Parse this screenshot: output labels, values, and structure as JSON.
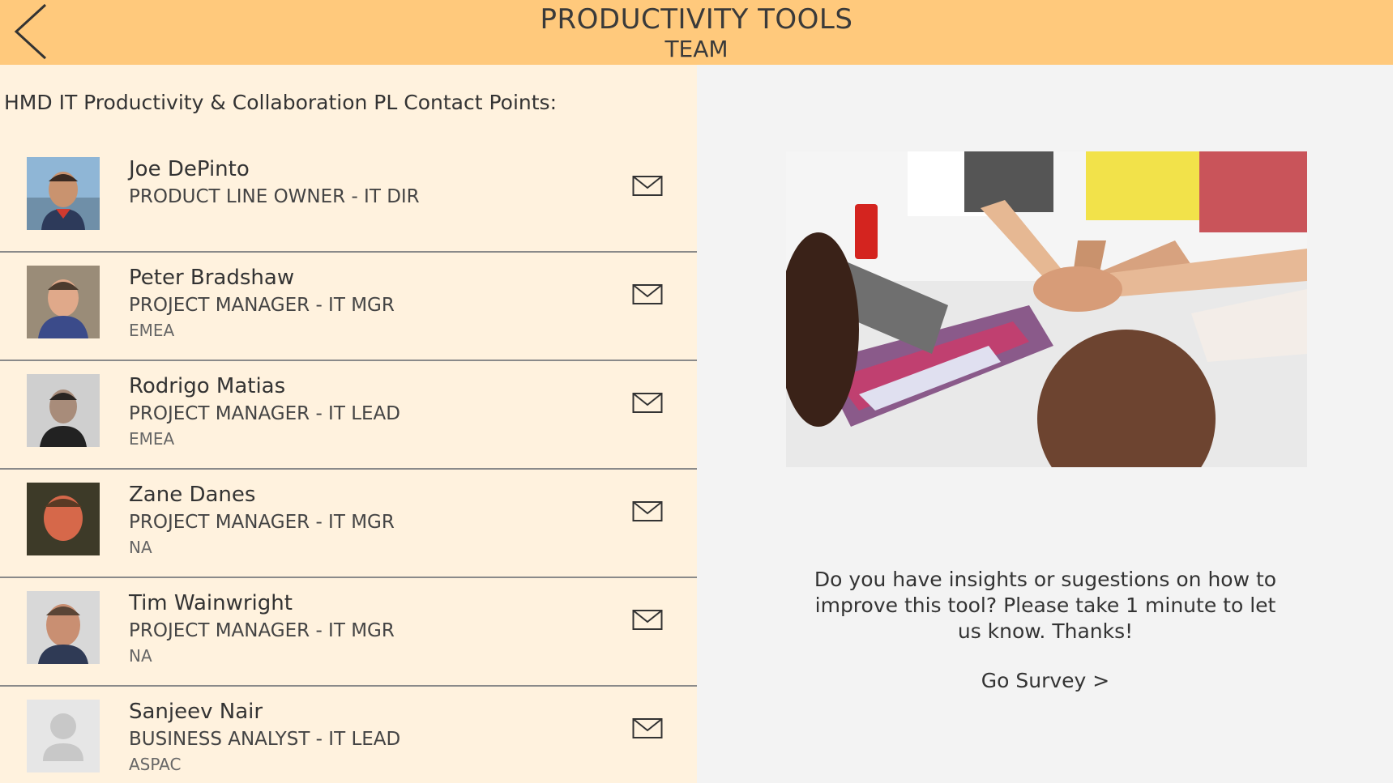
{
  "header": {
    "title": "PRODUCTIVITY TOOLS",
    "subtitle": "TEAM",
    "background_color": "#ffc97c"
  },
  "section_heading": "HMD IT Productivity & Collaboration PL Contact Points:",
  "contacts": [
    {
      "name": "Joe DePinto",
      "role": "PRODUCT LINE OWNER - IT DIR",
      "region": ""
    },
    {
      "name": "Peter Bradshaw",
      "role": "PROJECT MANAGER - IT MGR",
      "region": "EMEA"
    },
    {
      "name": "Rodrigo Matias",
      "role": "PROJECT MANAGER - IT LEAD",
      "region": "EMEA"
    },
    {
      "name": "Zane Danes",
      "role": "PROJECT MANAGER - IT MGR",
      "region": "NA"
    },
    {
      "name": "Tim Wainwright",
      "role": "PROJECT MANAGER - IT MGR",
      "region": "NA"
    },
    {
      "name": "Sanjeev Nair",
      "role": "BUSINESS ANALYST - IT LEAD",
      "region": "ASPAC"
    }
  ],
  "survey": {
    "text": "Do you have insights or sugestions on how to improve this tool? Please take 1 minute to let us know. Thanks!",
    "link_label": "Go Survey >"
  },
  "icons": {
    "back": "chevron-left-icon",
    "mail": "envelope-icon",
    "placeholder_avatar": "person-icon"
  },
  "colors": {
    "left_panel_bg": "#fff2de",
    "right_panel_bg": "#f3f3f3"
  }
}
